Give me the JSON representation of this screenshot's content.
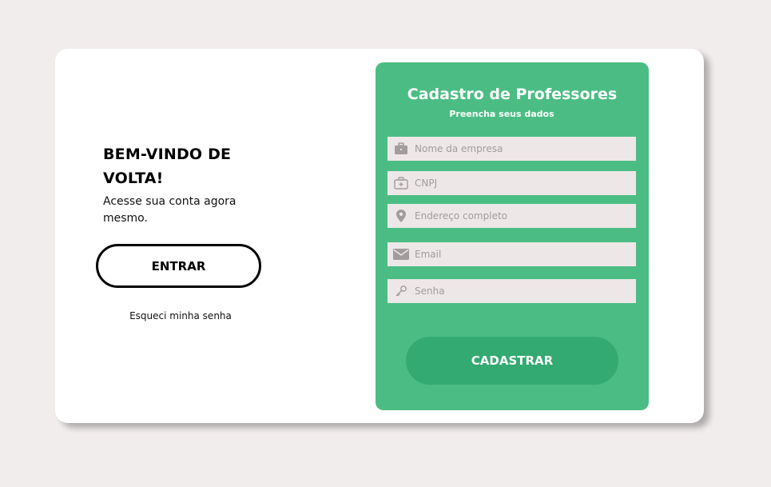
{
  "welcome": {
    "heading": "BEM-VINDO DE VOLTA!",
    "subtext": "Acesse sua conta agora mesmo.",
    "login_button": "ENTRAR",
    "forgot_link": "Esqueci minha senha"
  },
  "form": {
    "title": "Cadastro de Professores",
    "subtitle": "Preencha seus dados",
    "fields": [
      {
        "placeholder": "Nome da empresa",
        "icon": "briefcase-icon",
        "value": ""
      },
      {
        "placeholder": "CNPJ",
        "icon": "medical-kit-icon",
        "value": ""
      },
      {
        "placeholder": "Endereço completo",
        "icon": "location-pin-icon",
        "value": ""
      },
      {
        "placeholder": "Email",
        "icon": "envelope-icon",
        "value": ""
      },
      {
        "placeholder": "Senha",
        "icon": "key-icon",
        "value": ""
      }
    ],
    "submit_button": "CADASTRAR"
  },
  "colors": {
    "page_background": "#f2eded",
    "card_background": "#ffffff",
    "panel_green": "#4bbd84",
    "button_green": "#32aa71",
    "field_background": "#ede7e7",
    "icon_color": "#a39c9c"
  }
}
